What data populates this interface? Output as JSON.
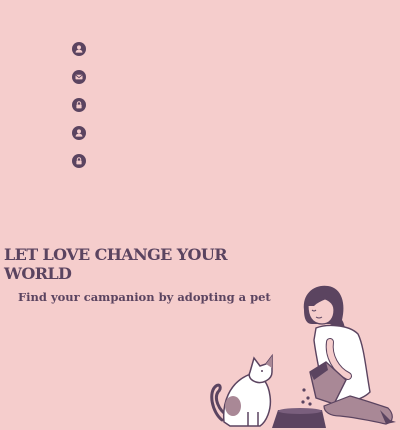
{
  "colors": {
    "background": "#f5cdcc",
    "text": "#5b4460",
    "icon": "#5b4460"
  },
  "form": {
    "icons": [
      "user-icon",
      "envelope-icon",
      "lock-icon",
      "user-icon",
      "lock-icon"
    ]
  },
  "hero": {
    "title": "LET LOVE CHANGE YOUR WORLD",
    "subtitle": "Find your campanion by adopting a pet"
  },
  "illustration": {
    "description_icon": "girl-feeding-cat-illustration"
  }
}
